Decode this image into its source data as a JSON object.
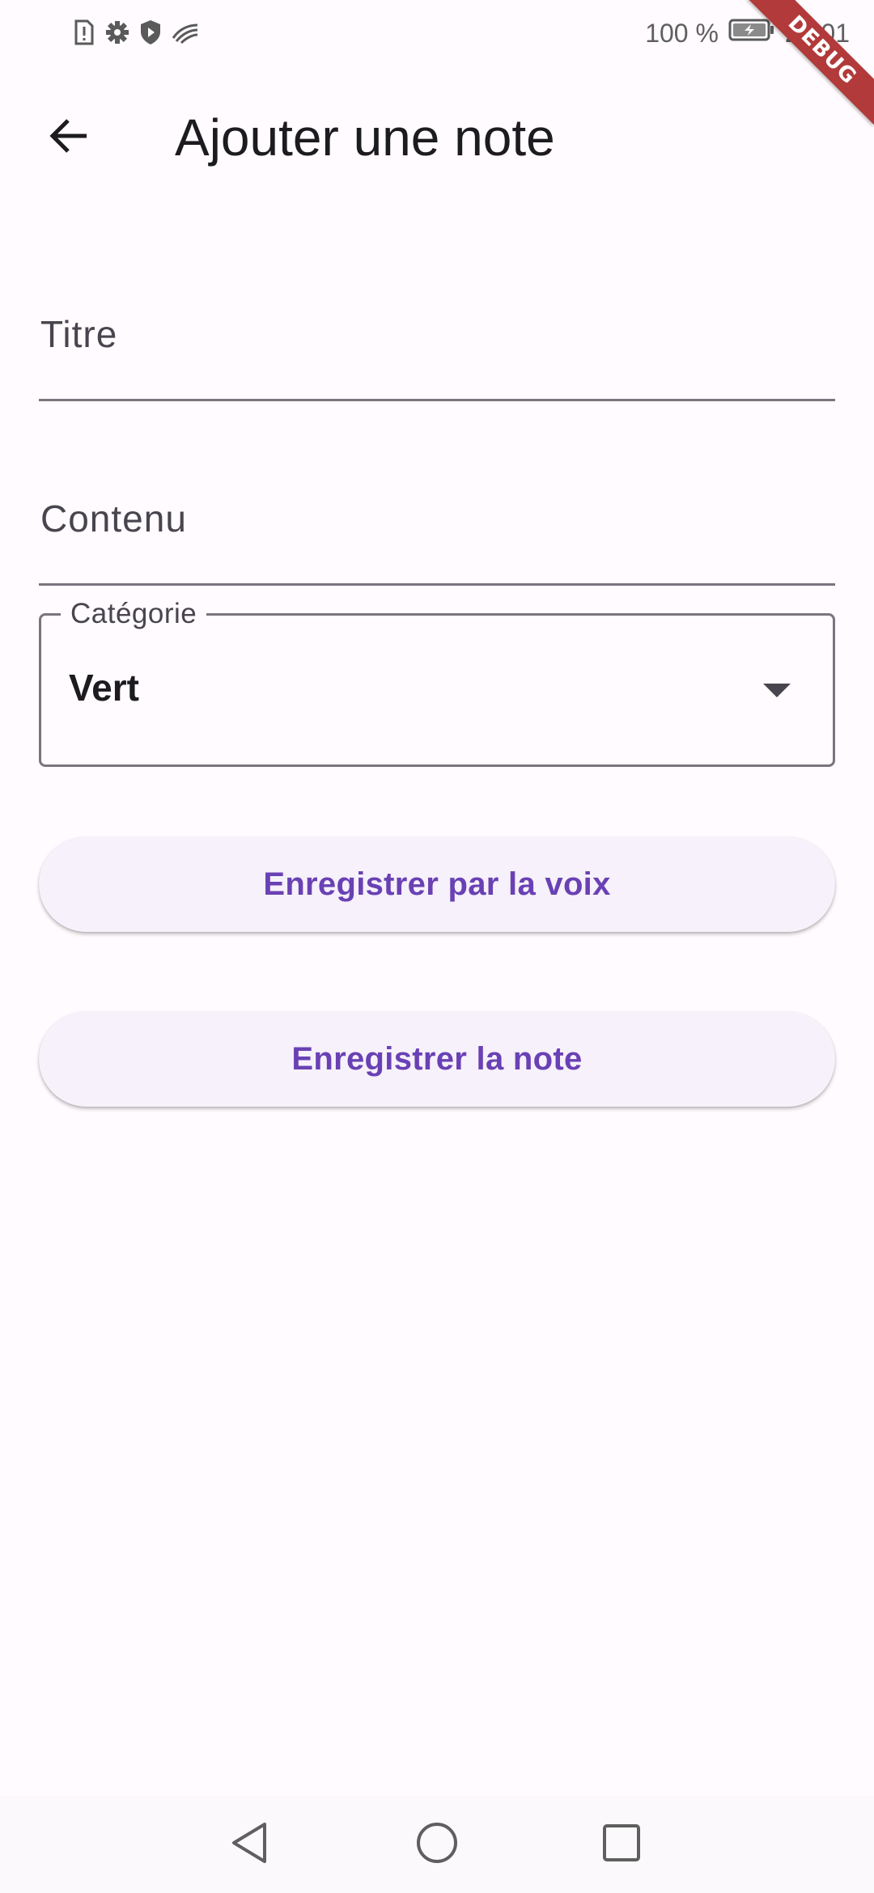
{
  "status_bar": {
    "battery_percent_text": "100 %",
    "time": "20:01",
    "icons": [
      "sim-alert-icon",
      "settings-gear-icon",
      "shield-play-icon",
      "swiftkey-icon",
      "battery-charging-icon"
    ]
  },
  "debug_banner": {
    "label": "DEBUG"
  },
  "app_bar": {
    "title": "Ajouter une note",
    "back_icon": "arrow-left-icon"
  },
  "form": {
    "title_field": {
      "label": "Titre",
      "value": ""
    },
    "content_field": {
      "label": "Contenu",
      "value": ""
    },
    "category": {
      "label": "Catégorie",
      "selected": "Vert",
      "icon": "dropdown-arrow-icon"
    },
    "voice_button_label": "Enregistrer par la voix",
    "save_button_label": "Enregistrer la note"
  },
  "nav_bar": {
    "icons": [
      "nav-back-icon",
      "nav-home-icon",
      "nav-recents-icon"
    ]
  },
  "colors": {
    "background": "#FFFBFE",
    "accent": "#6A41B4",
    "button_bg": "#F6F1FA",
    "outline": "#79747E",
    "debug_ribbon": "#B23A3A"
  }
}
